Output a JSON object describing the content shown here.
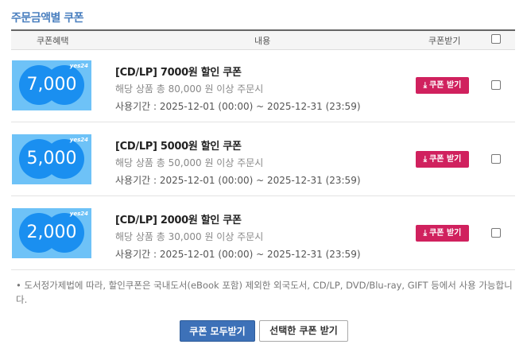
{
  "section_title": "주문금액별 쿠폰",
  "table_header": {
    "benefit": "쿠폰혜택",
    "content": "내용",
    "receive": "쿠폰받기"
  },
  "coupons": [
    {
      "amount": "7,000",
      "brand": "yes24",
      "name": "[CD/LP] 7000원 할인 쿠폰",
      "condition": "해당 상품 총 80,000 원 이상 주문시",
      "period": "사용기간 : 2025-12-01 (00:00) ~ 2025-12-31 (23:59)",
      "button": "쿠폰 받기"
    },
    {
      "amount": "5,000",
      "brand": "yes24",
      "name": "[CD/LP] 5000원 할인 쿠폰",
      "condition": "해당 상품 총 50,000 원 이상 주문시",
      "period": "사용기간 : 2025-12-01 (00:00) ~ 2025-12-31 (23:59)",
      "button": "쿠폰 받기"
    },
    {
      "amount": "2,000",
      "brand": "yes24",
      "name": "[CD/LP] 2000원 할인 쿠폰",
      "condition": "해당 상품 총 30,000 원 이상 주문시",
      "period": "사용기간 : 2025-12-01 (00:00) ~ 2025-12-31 (23:59)",
      "button": "쿠폰 받기"
    }
  ],
  "note": "• 도서정가제법에 따라, 할인쿠폰은 국내도서(eBook 포함) 제외한 외국도서, CD/LP, DVD/Blu-ray, GIFT 등에서 사용 가능합니다.",
  "actions": {
    "receive_all": "쿠폰 모두받기",
    "receive_selected": "선택한 쿠폰 받기"
  },
  "colors": {
    "accent_pink": "#d0215e",
    "primary_blue": "#3d71b8",
    "ticket_blue": "#6ec2f7",
    "circle_blue": "#1a8ff0"
  },
  "icons": {
    "download": "download-icon"
  }
}
